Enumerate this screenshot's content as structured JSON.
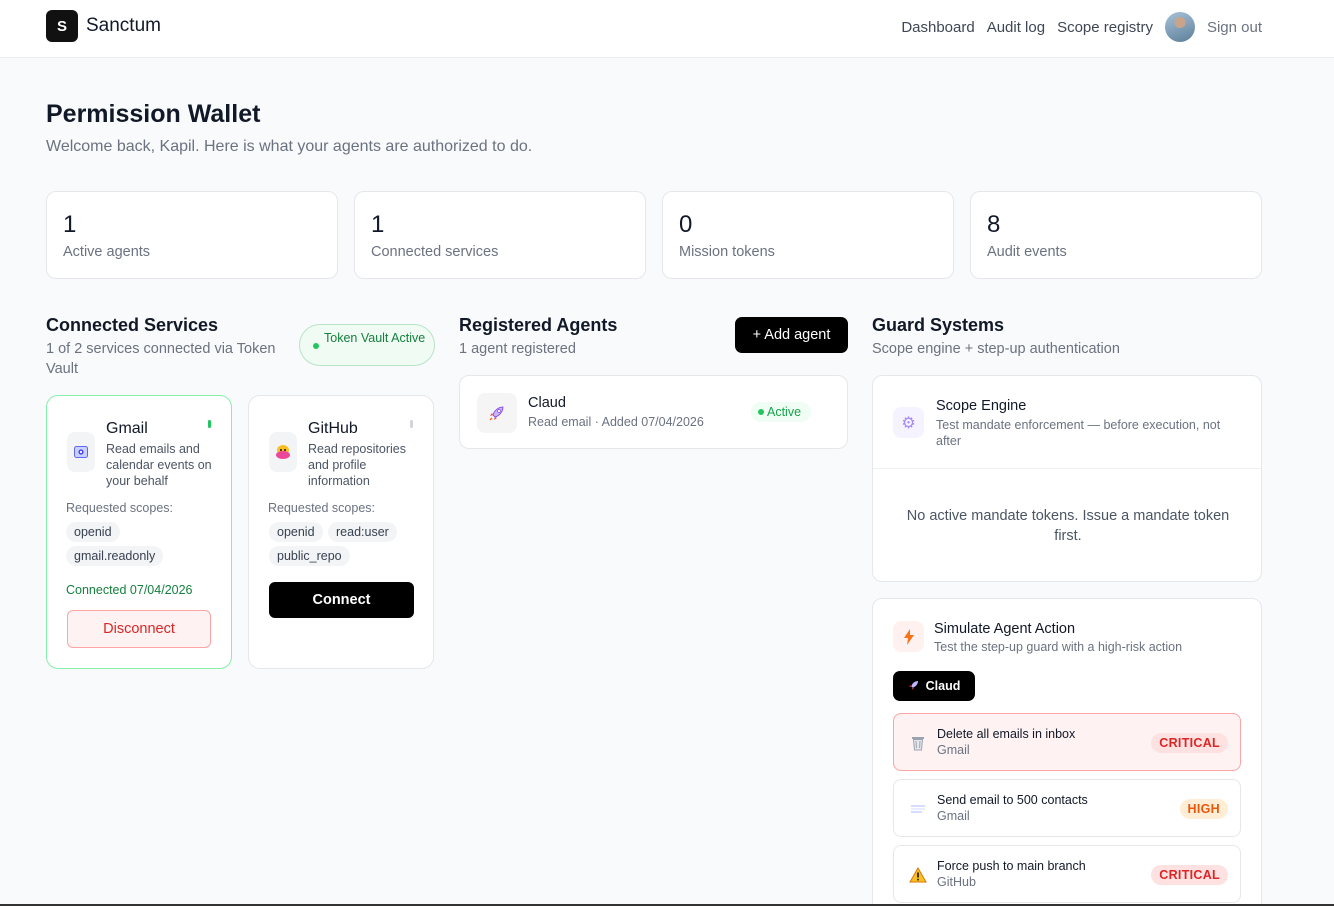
{
  "brand": {
    "logo_letter": "S",
    "name": "Sanctum"
  },
  "nav": {
    "items": [
      "Dashboard",
      "Audit log",
      "Scope registry"
    ],
    "sign_out": "Sign out"
  },
  "header": {
    "title": "Permission Wallet",
    "subtitle": "Welcome back, Kapil. Here is what your agents are authorized to do."
  },
  "stats": [
    {
      "value": "1",
      "label": "Active agents"
    },
    {
      "value": "1",
      "label": "Connected services"
    },
    {
      "value": "0",
      "label": "Mission tokens"
    },
    {
      "value": "8",
      "label": "Audit events"
    }
  ],
  "services": {
    "title": "Connected Services",
    "subtitle": "1 of 2 services connected via Token Vault",
    "vault_badge": "Token Vault Active",
    "requested_label": "Requested scopes:",
    "items": [
      {
        "name": "Gmail",
        "icon": "gmail-icon",
        "description": "Read emails and calendar events on your behalf",
        "scopes": [
          "openid",
          "gmail.readonly"
        ],
        "connected_text": "Connected 07/04/2026",
        "action": "Disconnect"
      },
      {
        "name": "GitHub",
        "icon": "github-icon",
        "description": "Read repositories and profile information",
        "scopes": [
          "openid",
          "read:user",
          "public_repo"
        ],
        "action": "Connect"
      }
    ]
  },
  "agents": {
    "title": "Registered Agents",
    "subtitle": "1 agent registered",
    "add_label": "+ Add agent",
    "items": [
      {
        "name": "Claud",
        "icon": "rocket-icon",
        "meta": "Read email · Added 07/04/2026",
        "status": "Active"
      }
    ]
  },
  "guards": {
    "title": "Guard Systems",
    "subtitle": "Scope engine + step-up authentication",
    "scope_engine": {
      "title": "Scope Engine",
      "subtitle": "Test mandate enforcement — before execution, not after",
      "empty": "No active mandate tokens. Issue a mandate token first."
    },
    "simulate": {
      "title": "Simulate Agent Action",
      "subtitle": "Test the step-up guard with a high-risk action",
      "agent": "Claud",
      "actions": [
        {
          "title": "Delete all emails in inbox",
          "service": "Gmail",
          "severity": "CRITICAL",
          "icon": "trash-icon"
        },
        {
          "title": "Send email to 500 contacts",
          "service": "Gmail",
          "severity": "HIGH",
          "icon": "mail-icon"
        },
        {
          "title": "Force push to main branch",
          "service": "GitHub",
          "severity": "CRITICAL",
          "icon": "warning-icon"
        }
      ]
    }
  },
  "colors": {
    "accent": "#000000",
    "success": "#15803d",
    "danger": "#dc2626",
    "warning": "#ea580c"
  }
}
